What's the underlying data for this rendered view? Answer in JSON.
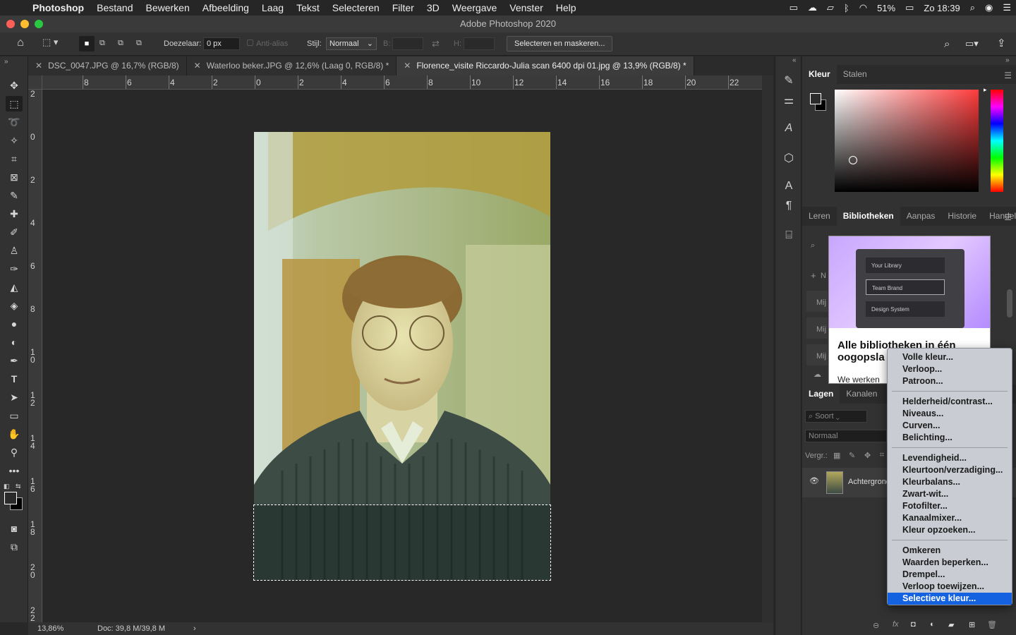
{
  "menubar": {
    "app": "Photoshop",
    "items": [
      "Bestand",
      "Bewerken",
      "Afbeelding",
      "Laag",
      "Tekst",
      "Selecteren",
      "Filter",
      "3D",
      "Weergave",
      "Venster",
      "Help"
    ],
    "battery": "51%",
    "clock": "Zo 18:39"
  },
  "window": {
    "title": "Adobe Photoshop 2020"
  },
  "options": {
    "feather_label": "Doezelaar:",
    "feather_value": "0 px",
    "antialias_label": "Anti-alias",
    "style_label": "Stijl:",
    "style_value": "Normaal",
    "width_label": "B:",
    "height_label": "H:",
    "select_mask_button": "Selecteren en maskeren..."
  },
  "tabs": [
    {
      "label": "DSC_0047.JPG @ 16,7% (RGB/8)"
    },
    {
      "label": "Waterloo beker.JPG @ 12,6% (Laag 0, RGB/8) *"
    },
    {
      "label": "Florence_visite Riccardo-Julia scan 6400 dpi 01.jpg @ 13,9% (RGB/8) *"
    }
  ],
  "ruler_h": [
    "8",
    "6",
    "4",
    "2",
    "0",
    "2",
    "4",
    "6",
    "8",
    "10",
    "12",
    "14",
    "16",
    "18",
    "20",
    "22"
  ],
  "ruler_v": [
    "2",
    "0",
    "2",
    "4",
    "6",
    "8",
    "1\n0",
    "1\n2",
    "1\n4",
    "1\n6",
    "1\n8",
    "2\n0",
    "2\n2"
  ],
  "status": {
    "zoom": "13,86%",
    "doc": "Doc: 39,8 M/39,8 M"
  },
  "color_panel": {
    "tabs": [
      "Kleur",
      "Stalen"
    ]
  },
  "libraries_panel": {
    "tabs": [
      "Leren",
      "Bibliotheken",
      "Aanpas",
      "Historie",
      "Handeli"
    ],
    "card_items": [
      "Your Library",
      "Team Brand",
      "Design System"
    ],
    "headline": "Alle bibliotheken in één oogopsla",
    "body_start": "We werken",
    "side_labels": [
      "Mij",
      "Mij",
      "Mij"
    ],
    "add_label": "N"
  },
  "layers_panel": {
    "tabs": [
      "Lagen",
      "Kanalen"
    ],
    "filter_label": "Soort",
    "blend_mode": "Normaal",
    "lock_label": "Vergr.:",
    "layer_name": "Achtergrond"
  },
  "dropdown": {
    "groups": [
      [
        "Volle kleur...",
        "Verloop...",
        "Patroon..."
      ],
      [
        "Helderheid/contrast...",
        "Niveaus...",
        "Curven...",
        "Belichting..."
      ],
      [
        "Levendigheid...",
        "Kleurtoon/verzadiging...",
        "Kleurbalans...",
        "Zwart-wit...",
        "Fotofilter...",
        "Kanaalmixer...",
        "Kleur opzoeken..."
      ],
      [
        "Omkeren",
        "Waarden beperken...",
        "Drempel...",
        "Verloop toewijzen...",
        "Selectieve kleur..."
      ]
    ],
    "highlighted": "Selectieve kleur..."
  }
}
